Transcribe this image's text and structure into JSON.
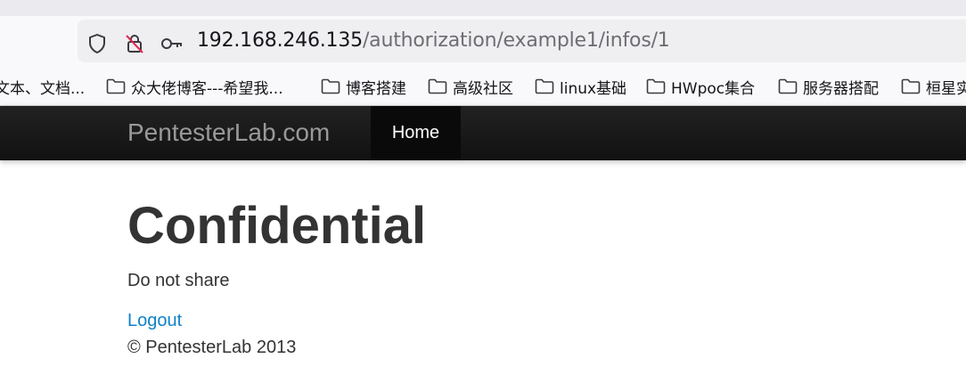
{
  "browser": {
    "url_host": "192.168.246.135",
    "url_path": "/authorization/example1/infos/1",
    "icons": [
      "shield-icon",
      "lock-crossed-icon",
      "key-icon"
    ]
  },
  "bookmarks": [
    {
      "label": "文本、文档...",
      "icon": "none"
    },
    {
      "label": "众大佬博客---希望我...",
      "icon": "folder-icon"
    },
    {
      "label": "博客搭建",
      "icon": "folder-icon"
    },
    {
      "label": "高级社区",
      "icon": "folder-icon"
    },
    {
      "label": "linux基础",
      "icon": "folder-icon"
    },
    {
      "label": "HWpoc集合",
      "icon": "folder-icon"
    },
    {
      "label": "服务器搭配",
      "icon": "folder-icon"
    },
    {
      "label": "桓星实",
      "icon": "folder-icon"
    }
  ],
  "navbar": {
    "brand": "PentesterLab.com",
    "home": "Home"
  },
  "main": {
    "title": "Confidential",
    "message": "Do not share",
    "logout": "Logout",
    "footer": "© PentesterLab 2013"
  },
  "colors": {
    "link": "#0f82c8",
    "navbar": "#1a1a1a",
    "text": "#333333"
  }
}
